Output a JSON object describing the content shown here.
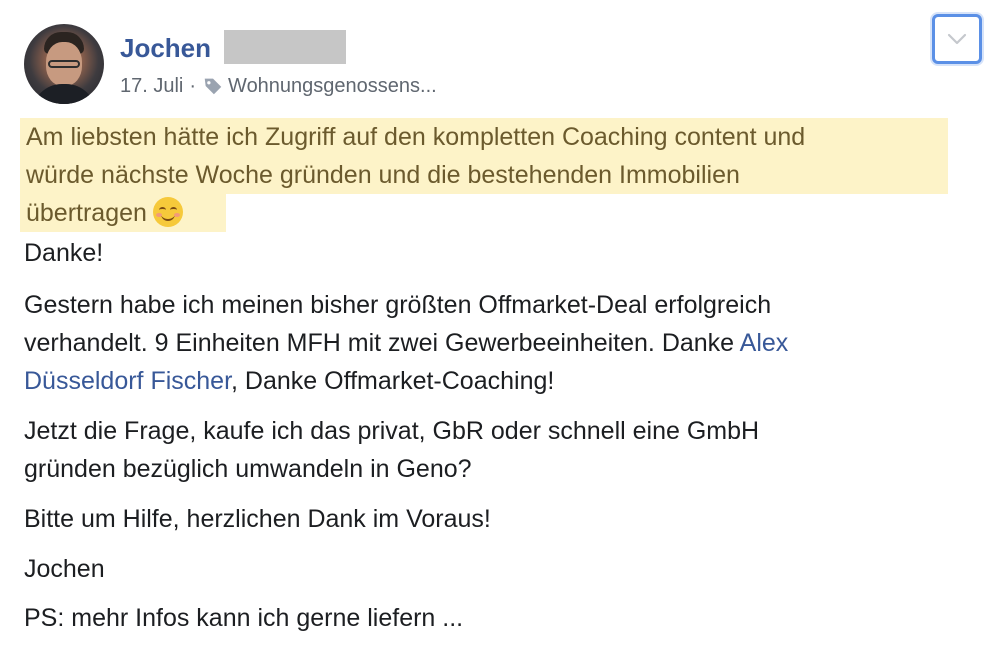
{
  "post": {
    "author_first_name": "Jochen",
    "date": "17. Juli",
    "separator": "·",
    "group_tag": "Wohnungsgenossens...",
    "icons": {
      "avatar": "profile-photo",
      "tag": "tag-icon",
      "menu": "chevron-down-icon"
    },
    "highlighted_lines": [
      "Am liebsten hätte ich Zugriff auf den kompletten Coaching content und",
      "würde nächste Woche gründen und die bestehenden Immobilien",
      "übertragen"
    ],
    "p1": "Danke!",
    "p2_line1": "Gestern habe ich meinen bisher größten Offmarket-Deal erfolgreich",
    "p2_line2_before_link": "verhandelt. 9 Einheiten MFH mit zwei Gewerbeeinheiten. Danke ",
    "p2_link_part1": "Alex",
    "p2_link_part2": "Düsseldorf Fischer",
    "p2_line3_after_link": ", Danke Offmarket-Coaching!",
    "p3_line1": "Jetzt die Frage, kaufe ich das privat, GbR oder schnell eine GmbH",
    "p3_line2": "gründen bezüglich umwandeln in Geno?",
    "p4": "Bitte um Hilfe, herzlichen Dank im Voraus!",
    "p5": "Jochen",
    "p6": "PS: mehr Infos kann ich gerne liefern ..."
  },
  "colors": {
    "link": "#385898",
    "highlight_bg": "#fdf3c8",
    "highlight_text": "#6b5a2d",
    "meta_text": "#606770",
    "menu_border": "#5b90e6"
  }
}
